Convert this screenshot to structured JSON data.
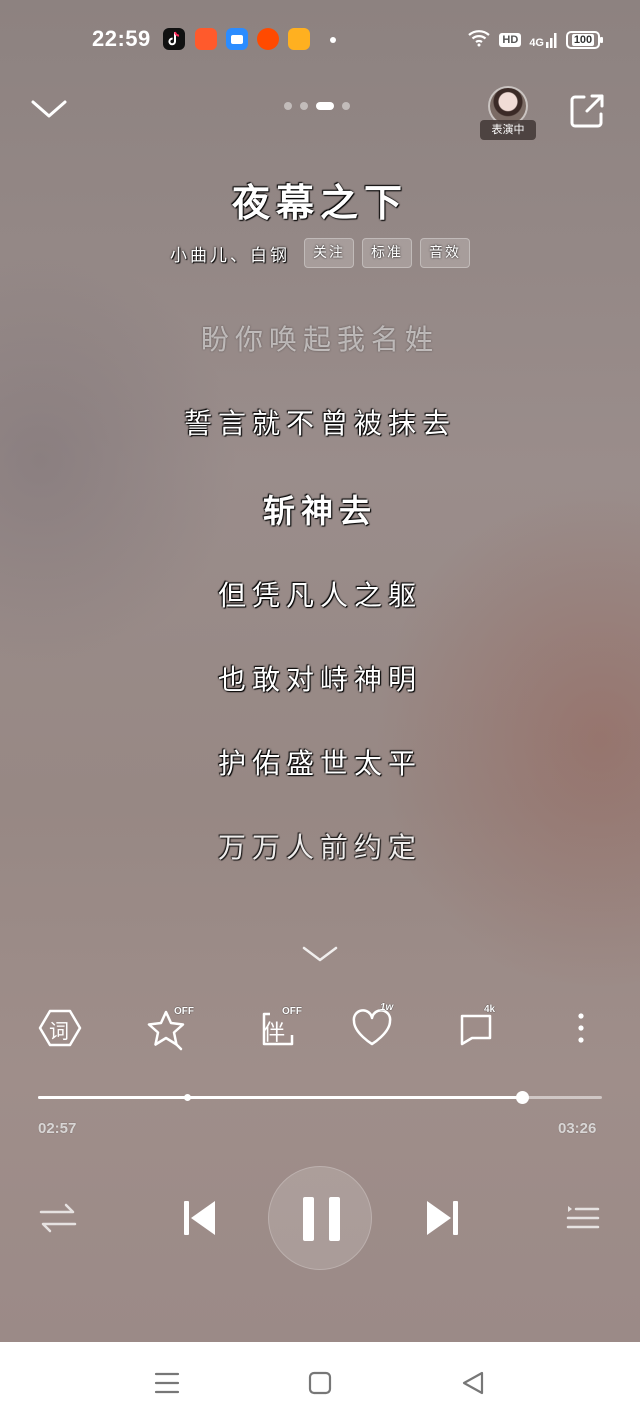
{
  "status_bar": {
    "time": "22:59",
    "network": "4G",
    "hd": "HD",
    "battery": "100"
  },
  "header": {
    "page_indicator": {
      "count": 4,
      "active": 2
    },
    "avatar_label": "表演中"
  },
  "song": {
    "title": "夜幕之下",
    "artists": "小曲儿、白钢",
    "tags": [
      "关注",
      "标准",
      "音效"
    ]
  },
  "lyrics": {
    "lines": [
      {
        "text": "盼你唤起我名姓",
        "state": "past"
      },
      {
        "text": "誓言就不曾被抹去",
        "state": "normal"
      },
      {
        "text": "斩神去",
        "state": "current"
      },
      {
        "text": "但凭凡人之躯",
        "state": "normal"
      },
      {
        "text": "也敢对峙神明",
        "state": "normal"
      },
      {
        "text": "护佑盛世太平",
        "state": "normal"
      },
      {
        "text": "万万人前约定",
        "state": "normal"
      }
    ]
  },
  "actions": {
    "lyrics_icon_label": "词",
    "favorite_badge": "OFF",
    "accompany_icon_label": "伴",
    "accompany_badge": "OFF",
    "like_count": "1w",
    "comment_count": "4k"
  },
  "playback": {
    "elapsed": "02:57",
    "duration": "03:26",
    "progress": 0.859,
    "marker": 0.265
  },
  "colors": {
    "background": "#978884",
    "foreground": "#ffffff",
    "nav_bar": "#ffffff"
  }
}
